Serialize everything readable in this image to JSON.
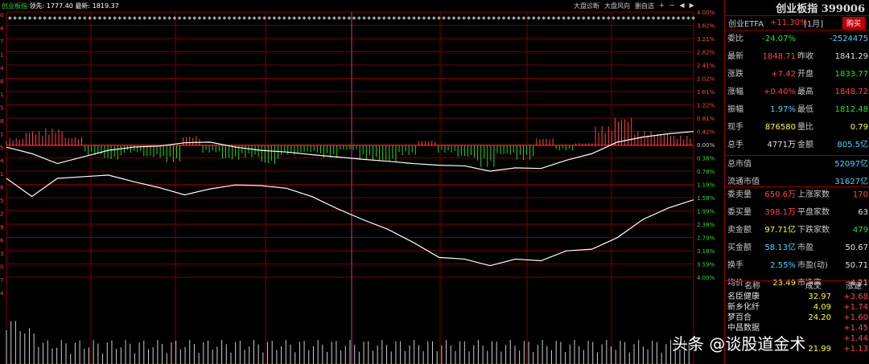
{
  "info_bar": {
    "name": "创业板指",
    "prev_label": "领先:",
    "prev_value": "1777.40",
    "latest_label": "最新:",
    "latest_value": "1819.37"
  },
  "top_buttons": [
    "大盘诊断",
    "大盘风向",
    "删自选",
    "+",
    "−",
    "◀",
    "▶"
  ],
  "left_axis": [
    "0",
    "4",
    "7",
    "1",
    "4",
    "8",
    "1",
    "5",
    "8",
    "1",
    "5",
    "4",
    "1",
    "8",
    "5",
    "2",
    "9",
    "6",
    "3",
    "0",
    "7",
    "4"
  ],
  "right_axis": [
    "4.00%",
    "3.62%",
    "3.21%",
    "2.82%",
    "2.41%",
    "2.02%",
    "1.61%",
    "1.22%",
    "0.81%",
    "0.42%",
    "0.00%",
    "0.38%",
    "0.78%",
    "1.19%",
    "1.58%",
    "1.99%",
    "2.38%",
    "2.79%",
    "3.18%",
    "3.59%",
    "4.00%"
  ],
  "panel": {
    "title": "创业板指 399006",
    "etf": {
      "name": "创业ETFA",
      "change": "+11.30%",
      "period": "[1月]",
      "buy": "购买"
    },
    "rows1": [
      {
        "l": "委比",
        "lv": "-24.07%",
        "r": "",
        "rv": "-2524475"
      },
      {
        "l": "最新",
        "lv": "1848.71",
        "r": "昨收",
        "rv": "1841.29"
      },
      {
        "l": "涨跌",
        "lv": "+7.42",
        "r": "开盘",
        "rv": "1833.77"
      },
      {
        "l": "涨幅",
        "lv": "+0.40%",
        "r": "最高",
        "rv": "1848.72"
      },
      {
        "l": "振幅",
        "lv": "1.97%",
        "r": "最低",
        "rv": "1812.48"
      },
      {
        "l": "现手",
        "lv": "876580",
        "r": "量比",
        "rv": "0.79"
      },
      {
        "l": "总手",
        "lv": "4771万",
        "r": "金额",
        "rv": "805.5亿"
      }
    ],
    "rows2": [
      {
        "l": "总市值",
        "rv": "52097亿"
      },
      {
        "l": "流通市值",
        "rv": "31627亿"
      }
    ],
    "rows3": [
      {
        "l": "委卖量",
        "lv": "650.6万",
        "r": "上涨家数",
        "rv": "170"
      },
      {
        "l": "委买量",
        "lv": "398.1万",
        "r": "平盘家数",
        "rv": "63"
      },
      {
        "l": "卖金额",
        "lv": "97.71亿",
        "r": "下跌家数",
        "rv": "479"
      },
      {
        "l": "买金额",
        "lv": "58.13亿",
        "r": "市盈",
        "rv": "50.67"
      },
      {
        "l": "换手",
        "lv": "2.55%",
        "r": "市盈(动)",
        "rv": "50.71"
      },
      {
        "l": "均价",
        "lv": "23.49",
        "r": "市净率",
        "rv": "4.21"
      }
    ],
    "movers_header": {
      "name": "名称",
      "price": "成交",
      "change": "涨速"
    },
    "movers": [
      {
        "name": "名臣健康",
        "price": "32.97",
        "change": "+3.68"
      },
      {
        "name": "新乡化纤",
        "price": "4.09",
        "change": "+1.74"
      },
      {
        "name": "梦百合",
        "price": "24.20",
        "change": "+1.60"
      },
      {
        "name": "中昌数据",
        "price": "",
        "change": "+1.45"
      },
      {
        "name": "",
        "price": "",
        "change": "+1.44"
      },
      {
        "name": "",
        "price": "21.99",
        "change": "+1.13"
      }
    ]
  },
  "watermark": "头条 @谈股道金术",
  "chart_data": {
    "type": "line",
    "title": "创业板指",
    "y_percent_range": [
      -4.0,
      4.0
    ],
    "series": [
      {
        "name": "最新",
        "values": [
          -0.05,
          -0.25,
          -0.55,
          -0.35,
          -0.15,
          -0.05,
          -0.02,
          0.08,
          0.1,
          -0.05,
          -0.15,
          -0.2,
          -0.28,
          -0.35,
          -0.42,
          -0.48,
          -0.55,
          -0.6,
          -0.62,
          -0.78,
          -0.68,
          -0.7,
          -0.45,
          -0.25,
          0.1,
          0.25,
          0.35,
          0.42
        ]
      },
      {
        "name": "均价",
        "values": [
          -1.0,
          -1.55,
          -1.0,
          -0.95,
          -0.9,
          -1.1,
          -1.28,
          -1.5,
          -1.32,
          -1.2,
          -1.22,
          -1.3,
          -1.55,
          -1.92,
          -2.25,
          -2.55,
          -2.95,
          -3.4,
          -3.45,
          -3.65,
          -3.45,
          -3.5,
          -3.2,
          -3.15,
          -2.8,
          -2.25,
          -1.9,
          -1.65
        ]
      }
    ],
    "bars": [
      0.3,
      0.6,
      0.7,
      0.35,
      -0.4,
      -0.6,
      -0.3,
      -0.5,
      -0.7,
      0.4,
      -0.3,
      -0.6,
      -0.5,
      -0.8,
      -0.4,
      -0.3,
      -0.5,
      -0.2,
      -0.6,
      -0.7,
      -0.4,
      0.2,
      -0.3,
      -0.5,
      -0.9,
      -0.4,
      -0.6,
      0.3,
      -0.2,
      0.1,
      0.8,
      1.2,
      0.6,
      0.5,
      0.4
    ]
  }
}
